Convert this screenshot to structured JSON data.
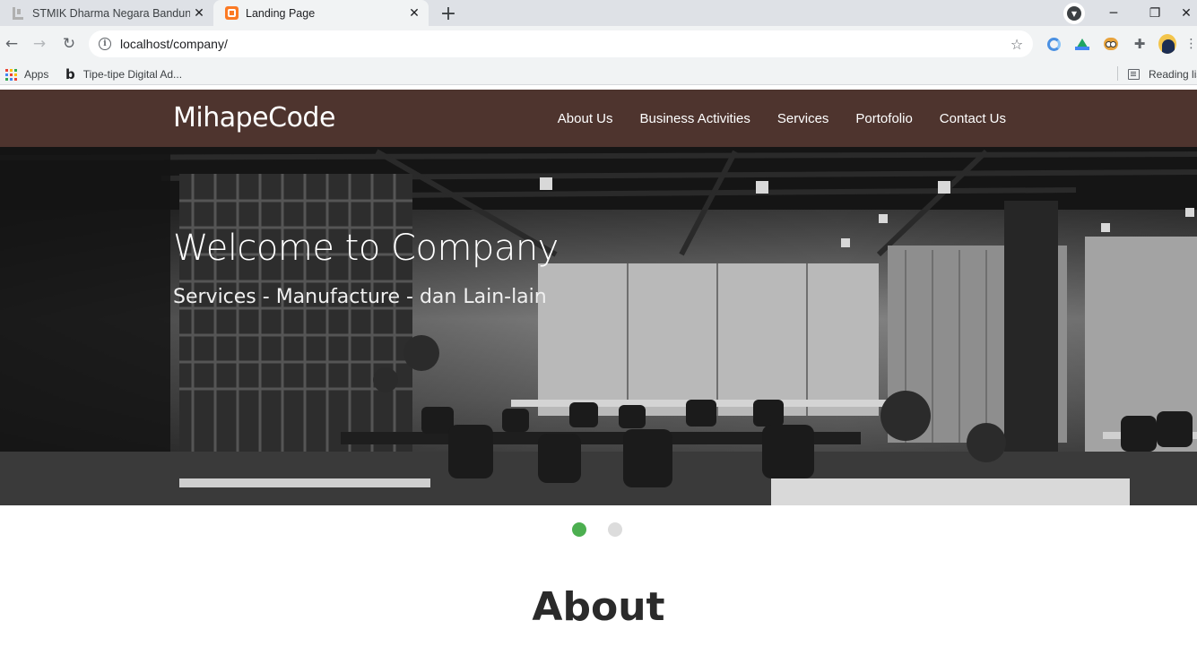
{
  "browser": {
    "tabs": [
      {
        "title": "STMIK Dharma Negara Bandung",
        "active": false,
        "favicon": "stmik-icon"
      },
      {
        "title": "Landing Page",
        "active": true,
        "favicon": "xampp-icon"
      }
    ],
    "url": "localhost/company/",
    "bookmarks": {
      "apps_label": "Apps",
      "item_label": "Tipe-tipe Digital Ad...",
      "reading_list_label": "Reading list"
    }
  },
  "site": {
    "brand": "MihapeCode",
    "nav": [
      "About Us",
      "Business Activities",
      "Services",
      "Portofolio",
      "Contact Us"
    ],
    "hero": {
      "title": "Welcome to Company",
      "subtitle": "Services - Manufacture - dan Lain-lain",
      "slide_active": 1,
      "slide_count": 2
    },
    "about_heading": "About",
    "colors": {
      "nav_bg": "#4e342e",
      "indicator_active": "#4caf50",
      "indicator_inactive": "#dcdcdc"
    }
  }
}
